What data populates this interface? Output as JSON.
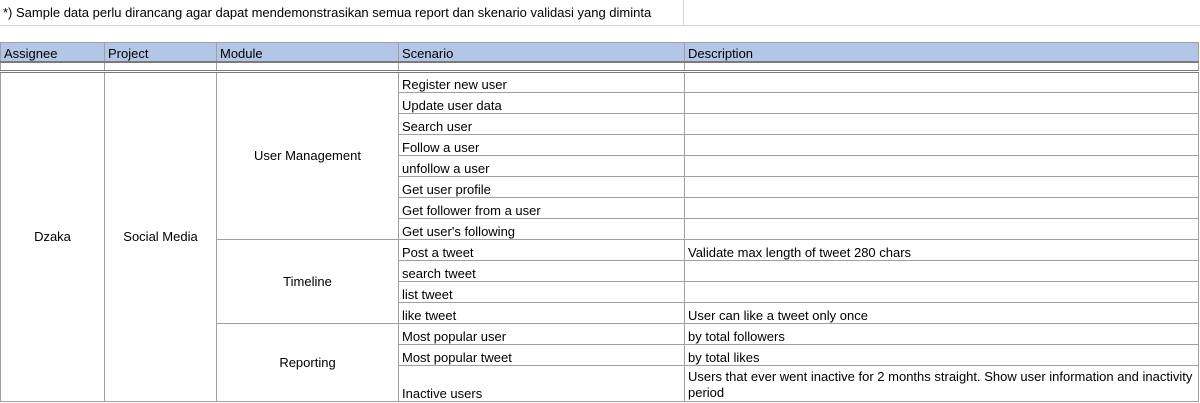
{
  "note": "*) Sample data perlu dirancang agar dapat mendemonstrasikan semua report dan skenario validasi yang diminta",
  "headers": [
    "Assignee",
    "Project",
    "Module",
    "Scenario",
    "Description"
  ],
  "assignee": "Dzaka",
  "project": "Social Media",
  "modules": [
    "User Management",
    "Timeline",
    "Reporting"
  ],
  "rows": [
    {
      "scenario": "Register new user",
      "description": ""
    },
    {
      "scenario": "Update user data",
      "description": ""
    },
    {
      "scenario": "Search user",
      "description": ""
    },
    {
      "scenario": "Follow a user",
      "description": ""
    },
    {
      "scenario": "unfollow a user",
      "description": ""
    },
    {
      "scenario": "Get user profile",
      "description": ""
    },
    {
      "scenario": "Get follower from a user",
      "description": ""
    },
    {
      "scenario": "Get user's following",
      "description": ""
    },
    {
      "scenario": "Post a tweet",
      "description": "Validate max length of tweet 280 chars"
    },
    {
      "scenario": "search tweet",
      "description": ""
    },
    {
      "scenario": "list tweet",
      "description": ""
    },
    {
      "scenario": "like tweet",
      "description": "User can like a tweet only once"
    },
    {
      "scenario": "Most popular user",
      "description": "by total followers"
    },
    {
      "scenario": "Most popular tweet",
      "description": "by total likes"
    },
    {
      "scenario": "Inactive users",
      "description": "Users that ever went inactive for 2 months straight. Show user information and inactivity period"
    }
  ]
}
